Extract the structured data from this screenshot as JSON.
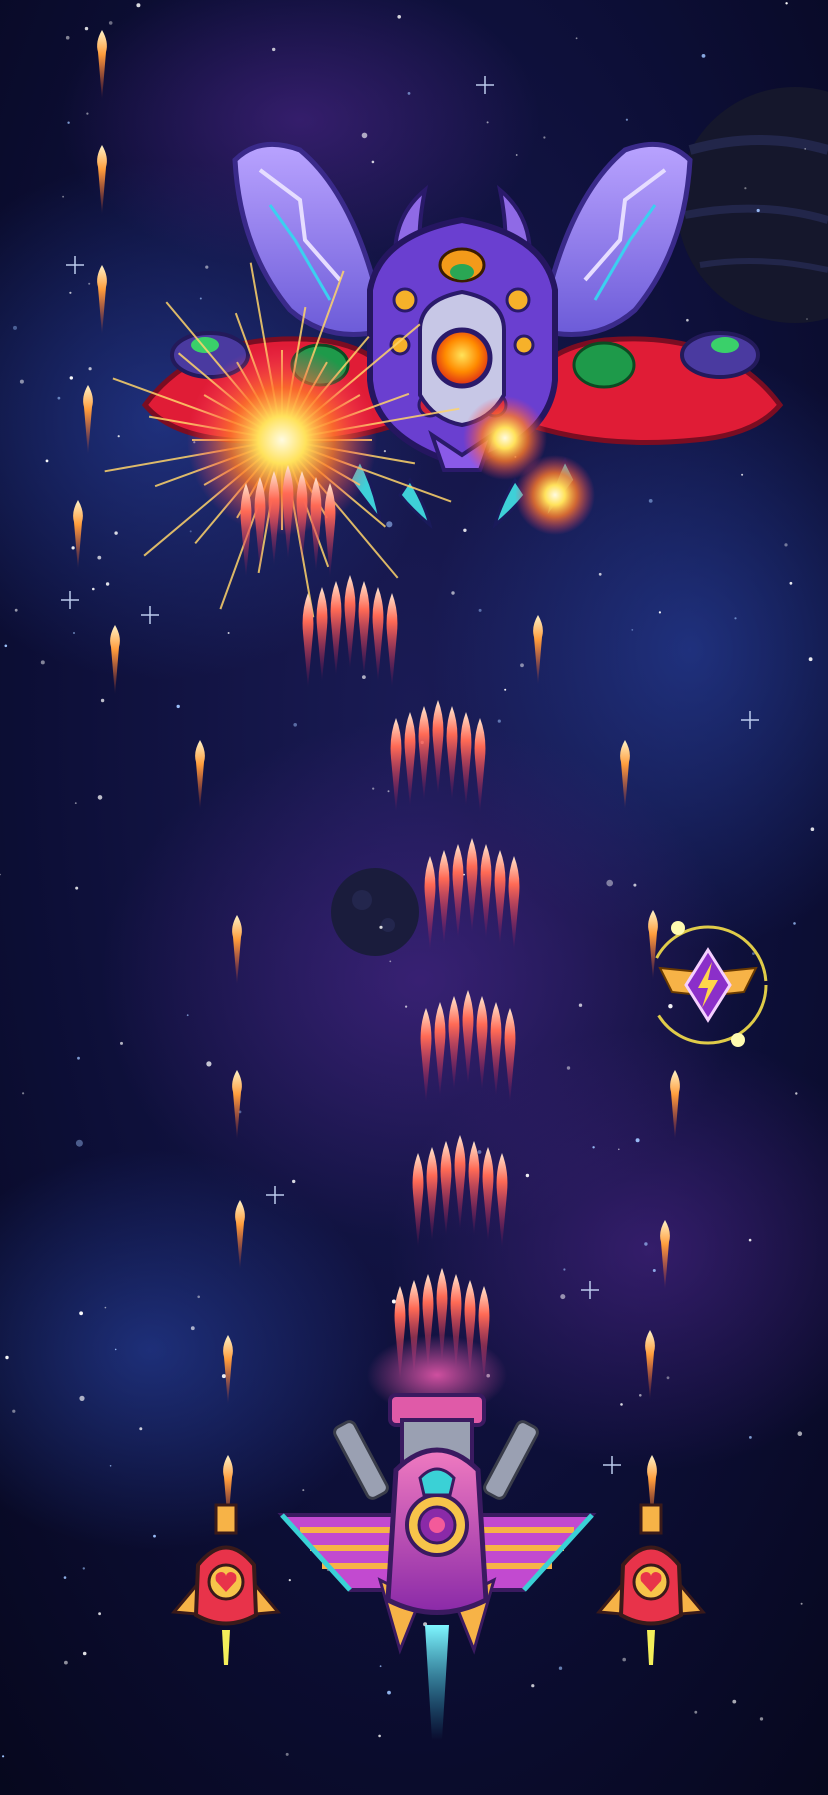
{
  "scene": {
    "kind": "vertical space shooter gameplay",
    "background": {
      "colors": {
        "deep": "#070923",
        "nebula_blue": "#1f3a8a",
        "nebula_purple": "#3b1f6e",
        "planet": "#16182e"
      }
    },
    "boss": {
      "name_icon": "beetle-boss-icon",
      "colors": {
        "shell": "#6a3fd0",
        "wing": "#9a7bf0",
        "red_pod": "#e21c34",
        "core": "#ff7a00",
        "green_eye": "#21a34a"
      }
    },
    "player": {
      "name_icon": "player-starship-icon",
      "colors": {
        "body": "#d2498f",
        "wing_stripe": "#f7b347",
        "accent": "#3ad1d6",
        "thruster": "#34e0e6"
      }
    },
    "wingmen": [
      {
        "side": "left",
        "icon": "wingman-drone-icon"
      },
      {
        "side": "right",
        "icon": "wingman-drone-icon"
      }
    ],
    "powerup": {
      "icon": "lightning-wing-badge-icon",
      "colors": {
        "ring": "#f6e04a",
        "badge": "#8b2fc9",
        "wing": "#f7b347"
      }
    },
    "projectiles": {
      "player_volley_colors": {
        "tip": "#ffe6cf",
        "mid": "#ff5f52",
        "tail": "#c0185f"
      },
      "drone_shot_color": "#ffb15a"
    }
  }
}
